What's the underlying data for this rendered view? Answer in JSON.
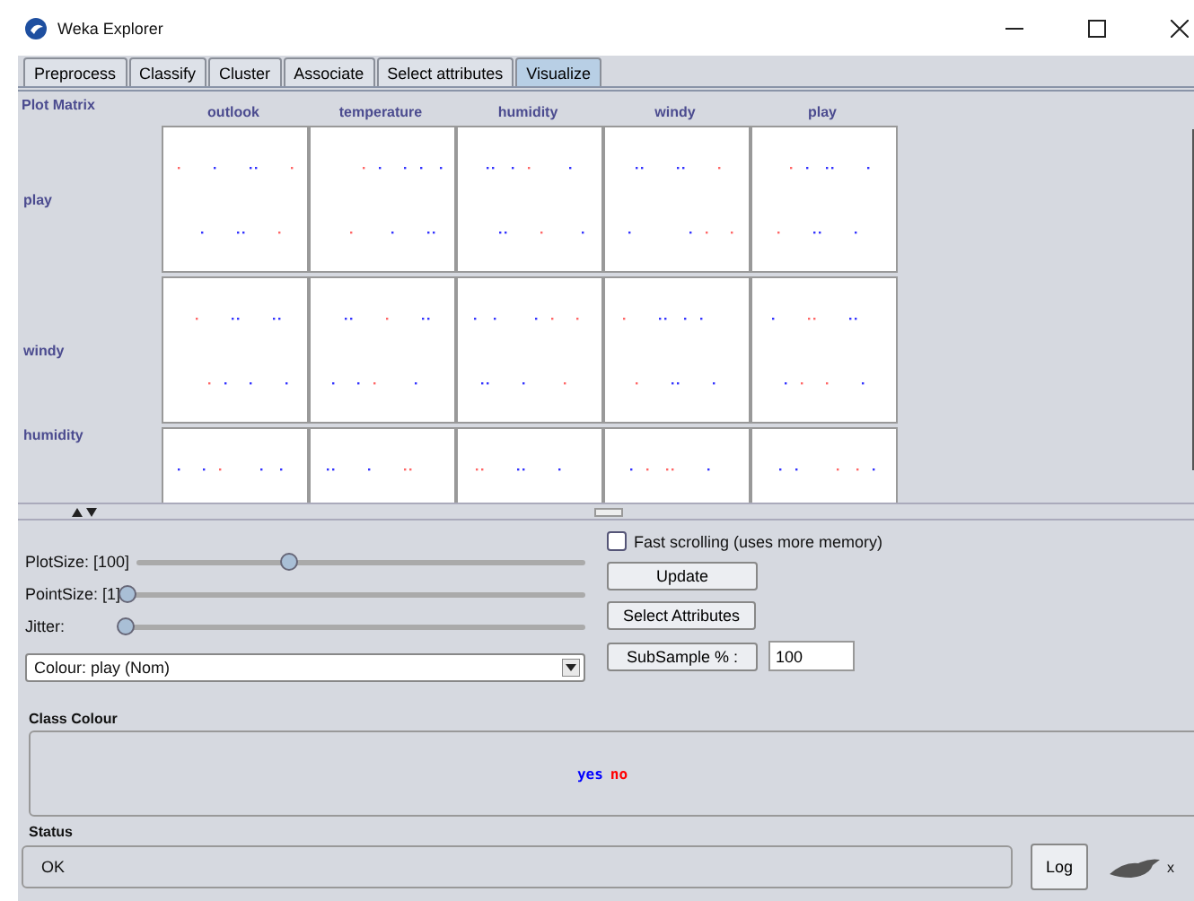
{
  "window": {
    "title": "Weka Explorer"
  },
  "tabs": [
    {
      "label": "Preprocess",
      "selected": false
    },
    {
      "label": "Classify",
      "selected": false
    },
    {
      "label": "Cluster",
      "selected": false
    },
    {
      "label": "Associate",
      "selected": false
    },
    {
      "label": "Select attributes",
      "selected": false
    },
    {
      "label": "Visualize",
      "selected": true
    }
  ],
  "plot_matrix": {
    "title": "Plot Matrix",
    "columns": [
      "outlook",
      "temperature",
      "humidity",
      "windy",
      "play"
    ],
    "rows": [
      "play",
      "windy",
      "humidity"
    ]
  },
  "controls": {
    "sliders": [
      {
        "label": "PlotSize: [100]",
        "level": 0.34
      },
      {
        "label": "PointSize: [1]",
        "level": 0
      },
      {
        "label": "Jitter:",
        "level": 0
      }
    ],
    "colour_dropdown": "Colour: play  (Nom)",
    "fast_scrolling": {
      "label": "Fast scrolling (uses more memory)",
      "checked": false
    },
    "update_button": "Update",
    "select_attributes_button": "Select Attributes",
    "subsample_button": "SubSample % :",
    "subsample_value": "100"
  },
  "class_colour": {
    "title": "Class Colour",
    "classes": [
      {
        "label": "yes",
        "color": "#0000ff"
      },
      {
        "label": "no",
        "color": "#ff0000"
      }
    ]
  },
  "status": {
    "title": "Status",
    "text": "OK",
    "log_button": "Log",
    "count": "x"
  }
}
